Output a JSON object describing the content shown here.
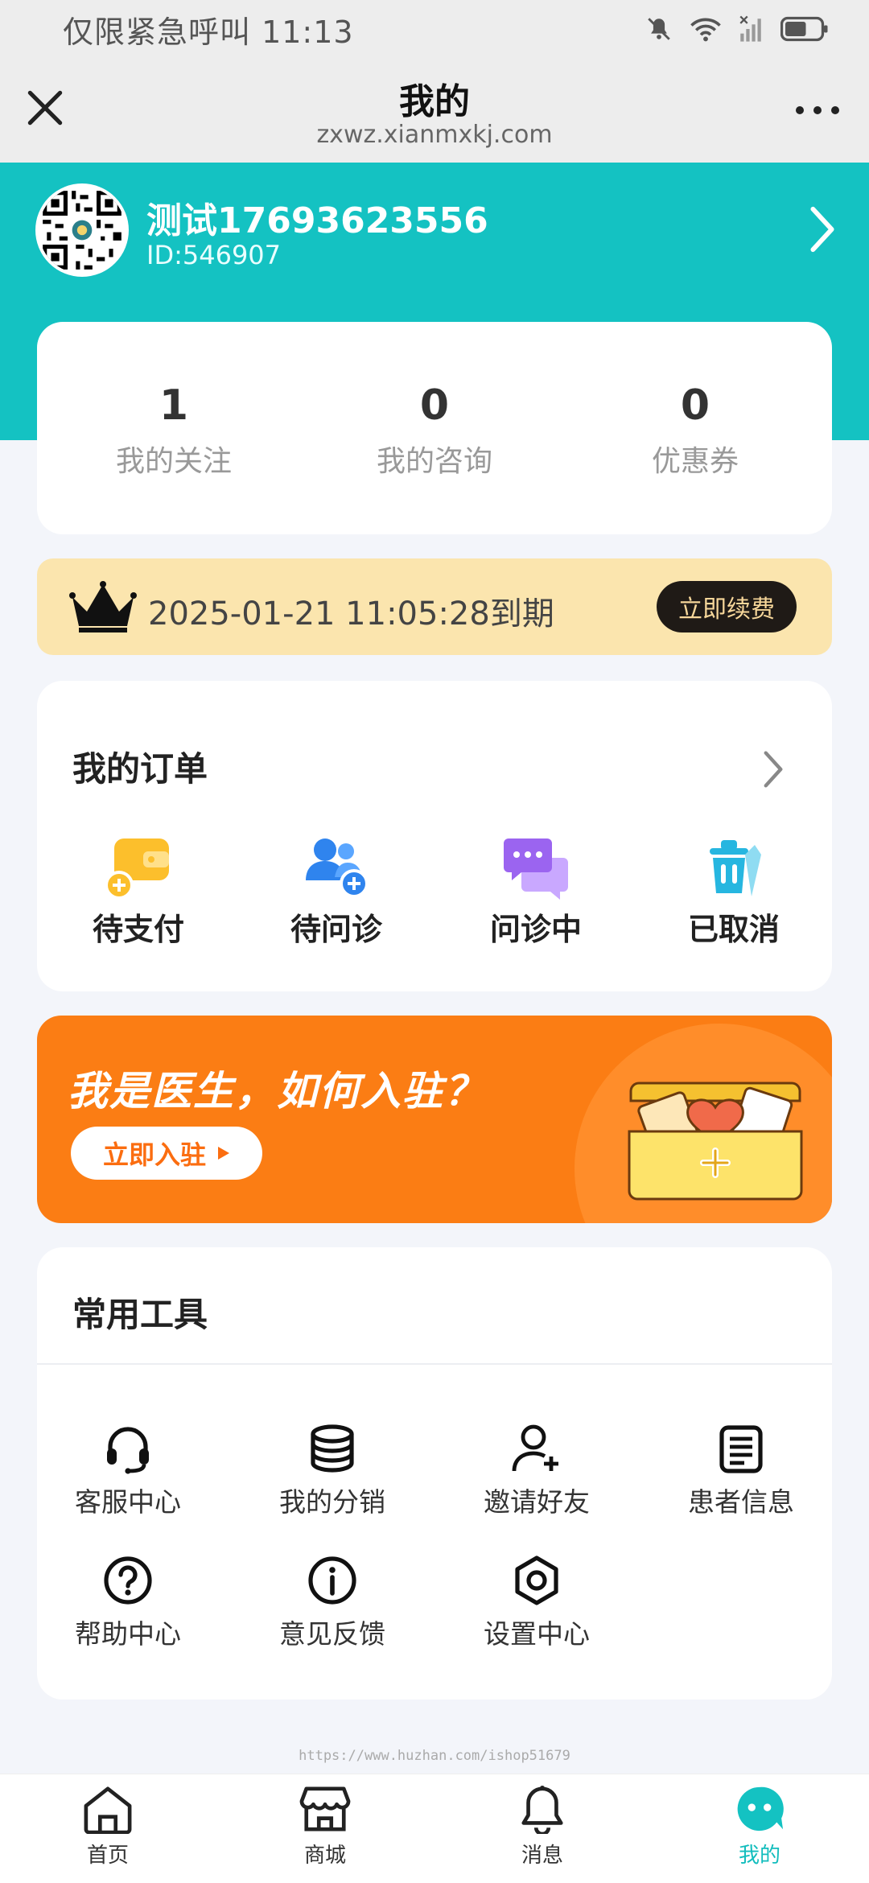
{
  "status_bar": {
    "text": "仅限紧急呼叫 11:13"
  },
  "header": {
    "title": "我的",
    "url": "zxwz.xianmxkj.com"
  },
  "profile": {
    "username": "测试17693623556",
    "user_id": "ID:546907"
  },
  "stats": [
    {
      "value": "1",
      "label": "我的关注"
    },
    {
      "value": "0",
      "label": "我的咨询"
    },
    {
      "value": "0",
      "label": "优惠券"
    }
  ],
  "vip": {
    "expiry_text": "2025-01-21 11:05:28到期",
    "renew_label": "立即续费"
  },
  "orders": {
    "title": "我的订单",
    "items": [
      {
        "label": "待支付",
        "icon": "wallet-icon"
      },
      {
        "label": "待问诊",
        "icon": "users-add-icon"
      },
      {
        "label": "问诊中",
        "icon": "chat-icon"
      },
      {
        "label": "已取消",
        "icon": "trash-icon"
      }
    ]
  },
  "banner": {
    "title": "我是医生，如何入驻？",
    "button_label": "立即入驻"
  },
  "tools": {
    "title": "常用工具",
    "items": [
      {
        "label": "客服中心",
        "icon": "headset-icon"
      },
      {
        "label": "我的分销",
        "icon": "coins-icon"
      },
      {
        "label": "邀请好友",
        "icon": "user-plus-icon"
      },
      {
        "label": "患者信息",
        "icon": "clipboard-icon"
      },
      {
        "label": "帮助中心",
        "icon": "help-icon"
      },
      {
        "label": "意见反馈",
        "icon": "info-icon"
      },
      {
        "label": "设置中心",
        "icon": "settings-icon"
      }
    ]
  },
  "watermark": "https://www.huzhan.com/ishop51679",
  "tabs": [
    {
      "label": "首页",
      "icon": "home-icon"
    },
    {
      "label": "商城",
      "icon": "shop-icon"
    },
    {
      "label": "消息",
      "icon": "bell-icon"
    },
    {
      "label": "我的",
      "icon": "mine-icon"
    }
  ],
  "colors": {
    "accent": "#14c2c2",
    "banner": "#fb7d14",
    "vip_bg": "#fbe5ae"
  }
}
